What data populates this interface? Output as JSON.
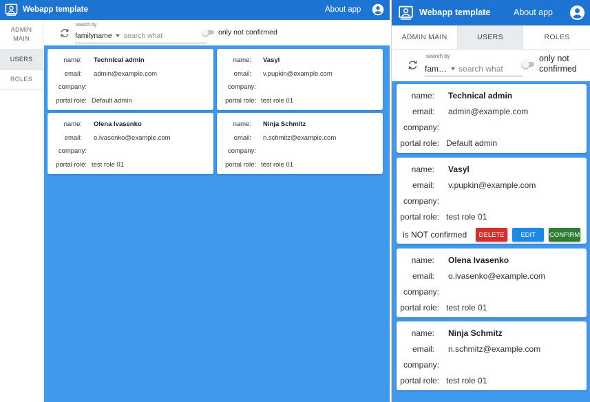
{
  "app": {
    "title": "Webapp template",
    "about_label": "About app",
    "bar_color": "#1e74d3",
    "content_color": "#4099ed"
  },
  "nav": {
    "items": [
      {
        "label": "ADMIN MAIN",
        "active": false
      },
      {
        "label": "USERS",
        "active": true
      },
      {
        "label": "ROLES",
        "active": false
      }
    ]
  },
  "search": {
    "label": "search by",
    "field_value": "familyname",
    "field_value_short": "fam…",
    "placeholder": "search what",
    "toggle_label": "only not confirmed",
    "toggle_on": false
  },
  "labels": {
    "name": "name:",
    "email": "email:",
    "company": "company:",
    "portal_role": "portal role:"
  },
  "users": [
    {
      "name": "Technical admin",
      "email": "admin@example.com",
      "company": "",
      "portal_role": "Default admin"
    },
    {
      "name": "Vasyl",
      "email": "v.pupkin@example.com",
      "company": "",
      "portal_role": "test role 01"
    },
    {
      "name": "Olena Ivasenko",
      "email": "o.ivasenko@example.com",
      "company": "",
      "portal_role": "test role 01"
    },
    {
      "name": "Ninja Schmitz",
      "email": "n.schmitz@example.com",
      "company": "",
      "portal_role": "test role 01"
    }
  ],
  "selected_user_actions": {
    "status_text": "is NOT confirmed",
    "delete_label": "DELETE",
    "edit_label": "EDIT",
    "confirm_label": "CONFIRM",
    "delete_color": "#d32f2f",
    "edit_color": "#1e88e5",
    "confirm_color": "#2e7d32"
  }
}
